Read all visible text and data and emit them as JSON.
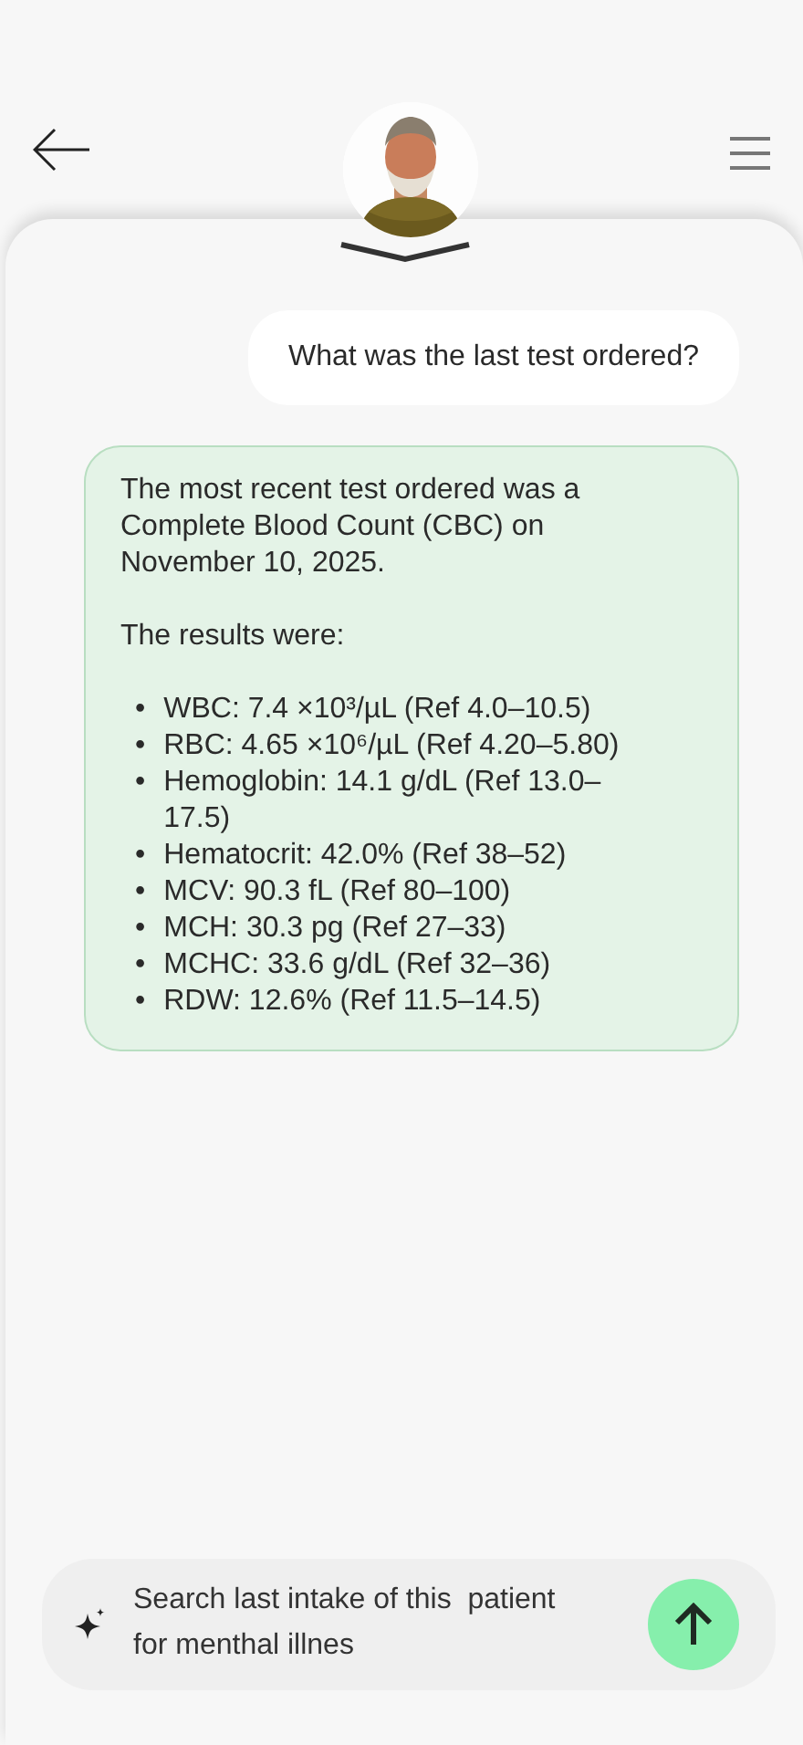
{
  "messages": [
    {
      "kind": "user",
      "text": "What was the last test ordered?"
    },
    {
      "kind": "assistant",
      "paragraphs": [
        "The most recent test ordered was a Complete Blood Count (CBC) on November 10, 2025.",
        "The results were:"
      ],
      "bullet": "•",
      "list": [
        "WBC: 7.4 ×10³/µL (Ref 4.0–10.5)",
        "RBC: 4.65 ×10⁶/µL (Ref 4.20–5.80)",
        "Hemoglobin: 14.1 g/dL (Ref 13.0–17.5)",
        "Hematocrit: 42.0% (Ref 38–52)",
        "MCV: 90.3 fL (Ref 80–100)",
        "MCH: 30.3 pg (Ref 27–33)",
        "MCHC: 33.6 g/dL (Ref 32–36)",
        "RDW: 12.6% (Ref 11.5–14.5)"
      ]
    }
  ],
  "composer": {
    "value": "Search last intake of this  patient for menthal illnes"
  }
}
